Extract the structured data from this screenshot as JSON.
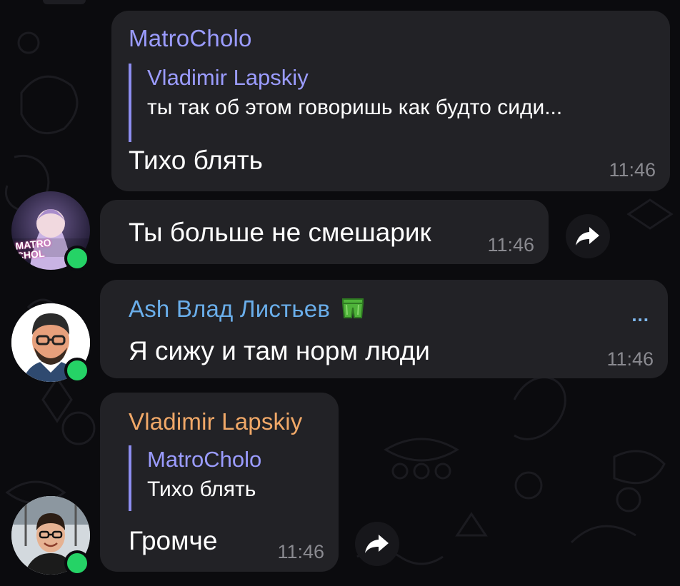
{
  "messages": [
    {
      "sender": "MatroCholo",
      "sender_color": "#9b9cff",
      "reply_to": {
        "name": "Vladimir Lapskiy",
        "text": "ты так об этом говоришь как будто сиди..."
      },
      "text": "Тихо блять",
      "time": "11:46"
    },
    {
      "text": "Ты больше не смешарик",
      "time": "11:46",
      "avatar_label": "MATRO CHOL",
      "share_icon": "share-arrow-icon"
    },
    {
      "sender": "Ash Влад Листьев",
      "sender_color": "#6aaeea",
      "sender_emoji": "shorts-icon",
      "menu": "...",
      "text": "Я сижу и там норм люди",
      "time": "11:46"
    },
    {
      "sender": "Vladimir Lapskiy",
      "sender_color": "#f0a868",
      "reply_to": {
        "name": "MatroCholo",
        "text": "Тихо блять"
      },
      "text": "Громче",
      "time": "11:46",
      "share_icon": "share-arrow-icon"
    }
  ],
  "colors": {
    "background": "#0b0b0e",
    "bubble": "#222226",
    "online": "#25d366",
    "timestamp": "#8a8a90"
  }
}
